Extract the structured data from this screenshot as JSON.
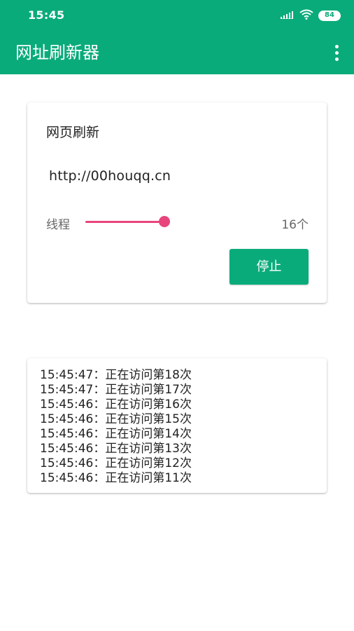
{
  "status_bar": {
    "time": "15:45",
    "battery": "84"
  },
  "app_bar": {
    "title": "网址刷新器"
  },
  "card": {
    "title": "网页刷新",
    "url": "http://00houqq.cn",
    "thread_label": "线程",
    "thread_count": "16个",
    "slider_fraction": 0.8,
    "stop_button": "停止"
  },
  "log": {
    "entries": [
      "15:45:47：正在访问第18次",
      "15:45:47：正在访问第17次",
      "15:45:46：正在访问第16次",
      "15:45:46：正在访问第15次",
      "15:45:46：正在访问第14次",
      "15:45:46：正在访问第13次",
      "15:45:46：正在访问第12次",
      "15:45:46：正在访问第11次"
    ]
  },
  "colors": {
    "primary": "#0aab7a",
    "accent": "#e8457c"
  },
  "icons": {
    "signal": "signal-icon",
    "wifi": "wifi-icon",
    "battery": "battery-icon",
    "overflow": "more-vert-icon"
  }
}
